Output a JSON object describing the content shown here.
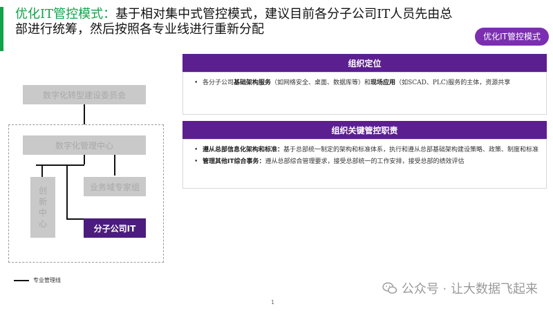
{
  "header": {
    "title_prefix": "优化IT管控模式：",
    "title_rest": "基于相对集中式管控模式，建议目前各分子公司IT人员先由总部进行统筹，然后按照各专业线进行重新分配",
    "badge": "优化IT管控模式"
  },
  "org_chart": {
    "committee": "数字化转型建设委员会",
    "center": "数字化管理中心",
    "innovation": "创新中心",
    "experts": "业务域专家组",
    "subsidiary": "分子公司IT",
    "legend": "专业管理线"
  },
  "panels": {
    "positioning": {
      "title": "组织定位",
      "items": [
        {
          "t1": "各分子公司",
          "b1": "基础架构服务",
          "t2": "（如网络安全、桌面、数据库等）和",
          "b2": "现场应用",
          "t3": "（如SCAD、PLC)服务的主体，资源共享"
        }
      ]
    },
    "duties": {
      "title": "组织关键管控职责",
      "items": [
        {
          "label": "遵从总部信息化架构和标准：",
          "text": "基于总部统一制定的架构和标准体系，执行和遵从总部基础架构建设策略、政策、制度和标准"
        },
        {
          "label": "管理其他IT综合事务：",
          "text": "遵从总部综合管理要求，接受总部统一的工作安排，接受总部的绩效评估"
        }
      ]
    }
  },
  "footer": {
    "page_number": "1",
    "watermark": "公众号 · 让大数据飞起来"
  },
  "colors": {
    "accent_green": "#12a24a",
    "purple": "#5c1f8f",
    "badge_purple": "#7b2fb0"
  },
  "icons": {
    "watermark": "wechat-icon"
  }
}
